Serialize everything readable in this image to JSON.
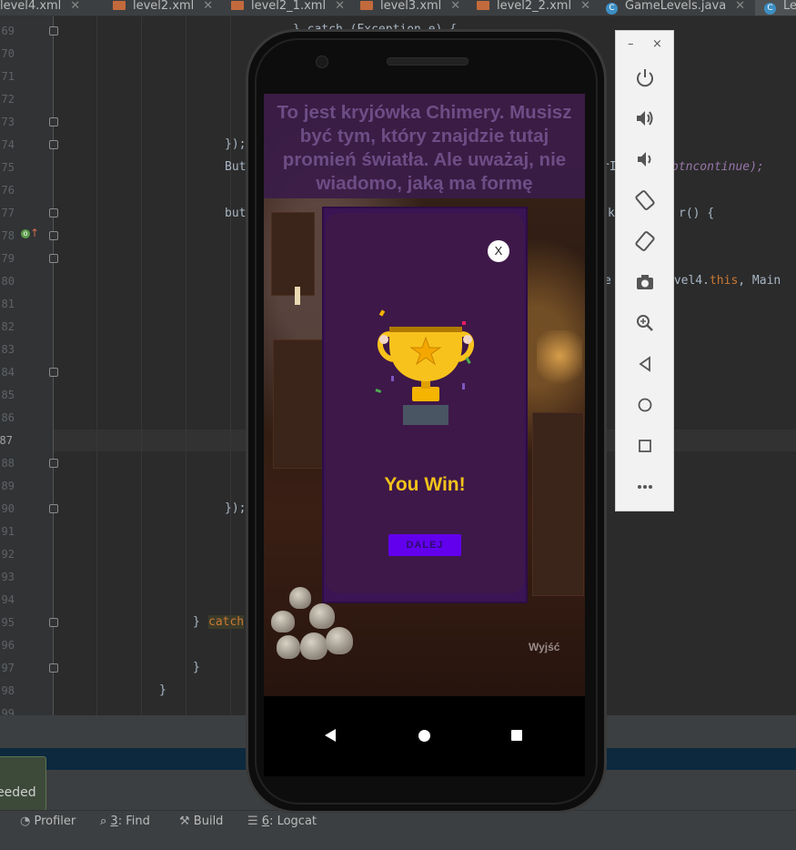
{
  "ide": {
    "tabs": [
      {
        "label": "level4.xml",
        "type": "xml"
      },
      {
        "label": "level2.xml",
        "type": "xml"
      },
      {
        "label": "level2_1.xml",
        "type": "xml"
      },
      {
        "label": "level3.xml",
        "type": "xml"
      },
      {
        "label": "level2_2.xml",
        "type": "xml"
      },
      {
        "label": "GameLevels.java",
        "type": "java"
      },
      {
        "label": "Le",
        "type": "java"
      }
    ],
    "line_numbers": [
      "69",
      "70",
      "71",
      "72",
      "73",
      "74",
      "75",
      "76",
      "77",
      "78",
      "79",
      "80",
      "81",
      "82",
      "83",
      "84",
      "85",
      "86",
      "87",
      "88",
      "89",
      "90",
      "91",
      "92",
      "93",
      "94",
      "95",
      "96",
      "97",
      "98",
      "99"
    ],
    "code": {
      "l69": "} catch (Exception e) {",
      "l74": "});",
      "l75_left": "But",
      "l75_right": "btncontinue);",
      "l75_mid": "rI",
      "l77_left": "but",
      "l77_right": "r() {",
      "l77_mid": "k",
      "l80_mid": "e",
      "l80_right_a": "evel4.",
      "l80_right_b": "this",
      "l80_right_c": ", Main",
      "l90": "});",
      "l95_brace": "}",
      "l95_catch": "catch",
      "l97": "}",
      "l98": "}"
    },
    "toast_text": "eeded",
    "bottom_tools": [
      {
        "label": "Profiler",
        "icon": "gauge-icon"
      },
      {
        "label": "3: Find",
        "underline": "3",
        "rest": ": Find",
        "icon": "search-icon"
      },
      {
        "label": "Build",
        "icon": "hammer-icon"
      },
      {
        "label": "6: Logcat",
        "underline": "6",
        "rest": ": Logcat",
        "icon": "list-icon"
      }
    ]
  },
  "app": {
    "banner_text": "To jest kryjówka Chimery. Musisz być tym, który znajdzie tutaj promień światła. Ale uważaj, nie wiadomo, jaką ma formę",
    "dialog": {
      "close_label": "X",
      "result_text": "You Win!",
      "continue_label": "DALEJ"
    },
    "exit_label": "Wyjść"
  },
  "emulator_toolbar": {
    "minimize_label": "–",
    "close_label": "×",
    "buttons": [
      "power-icon",
      "volume-up-icon",
      "volume-down-icon",
      "rotate-left-icon",
      "rotate-right-icon",
      "camera-icon",
      "zoom-icon",
      "back-icon",
      "home-icon",
      "overview-icon",
      "more-icon"
    ]
  },
  "colors": {
    "ide_bg": "#2b2b2b",
    "banner_text": "#6e4d86",
    "dialog_bg": "#3e1849",
    "win_text": "#f2c31a",
    "button_bg": "#6200ee"
  }
}
